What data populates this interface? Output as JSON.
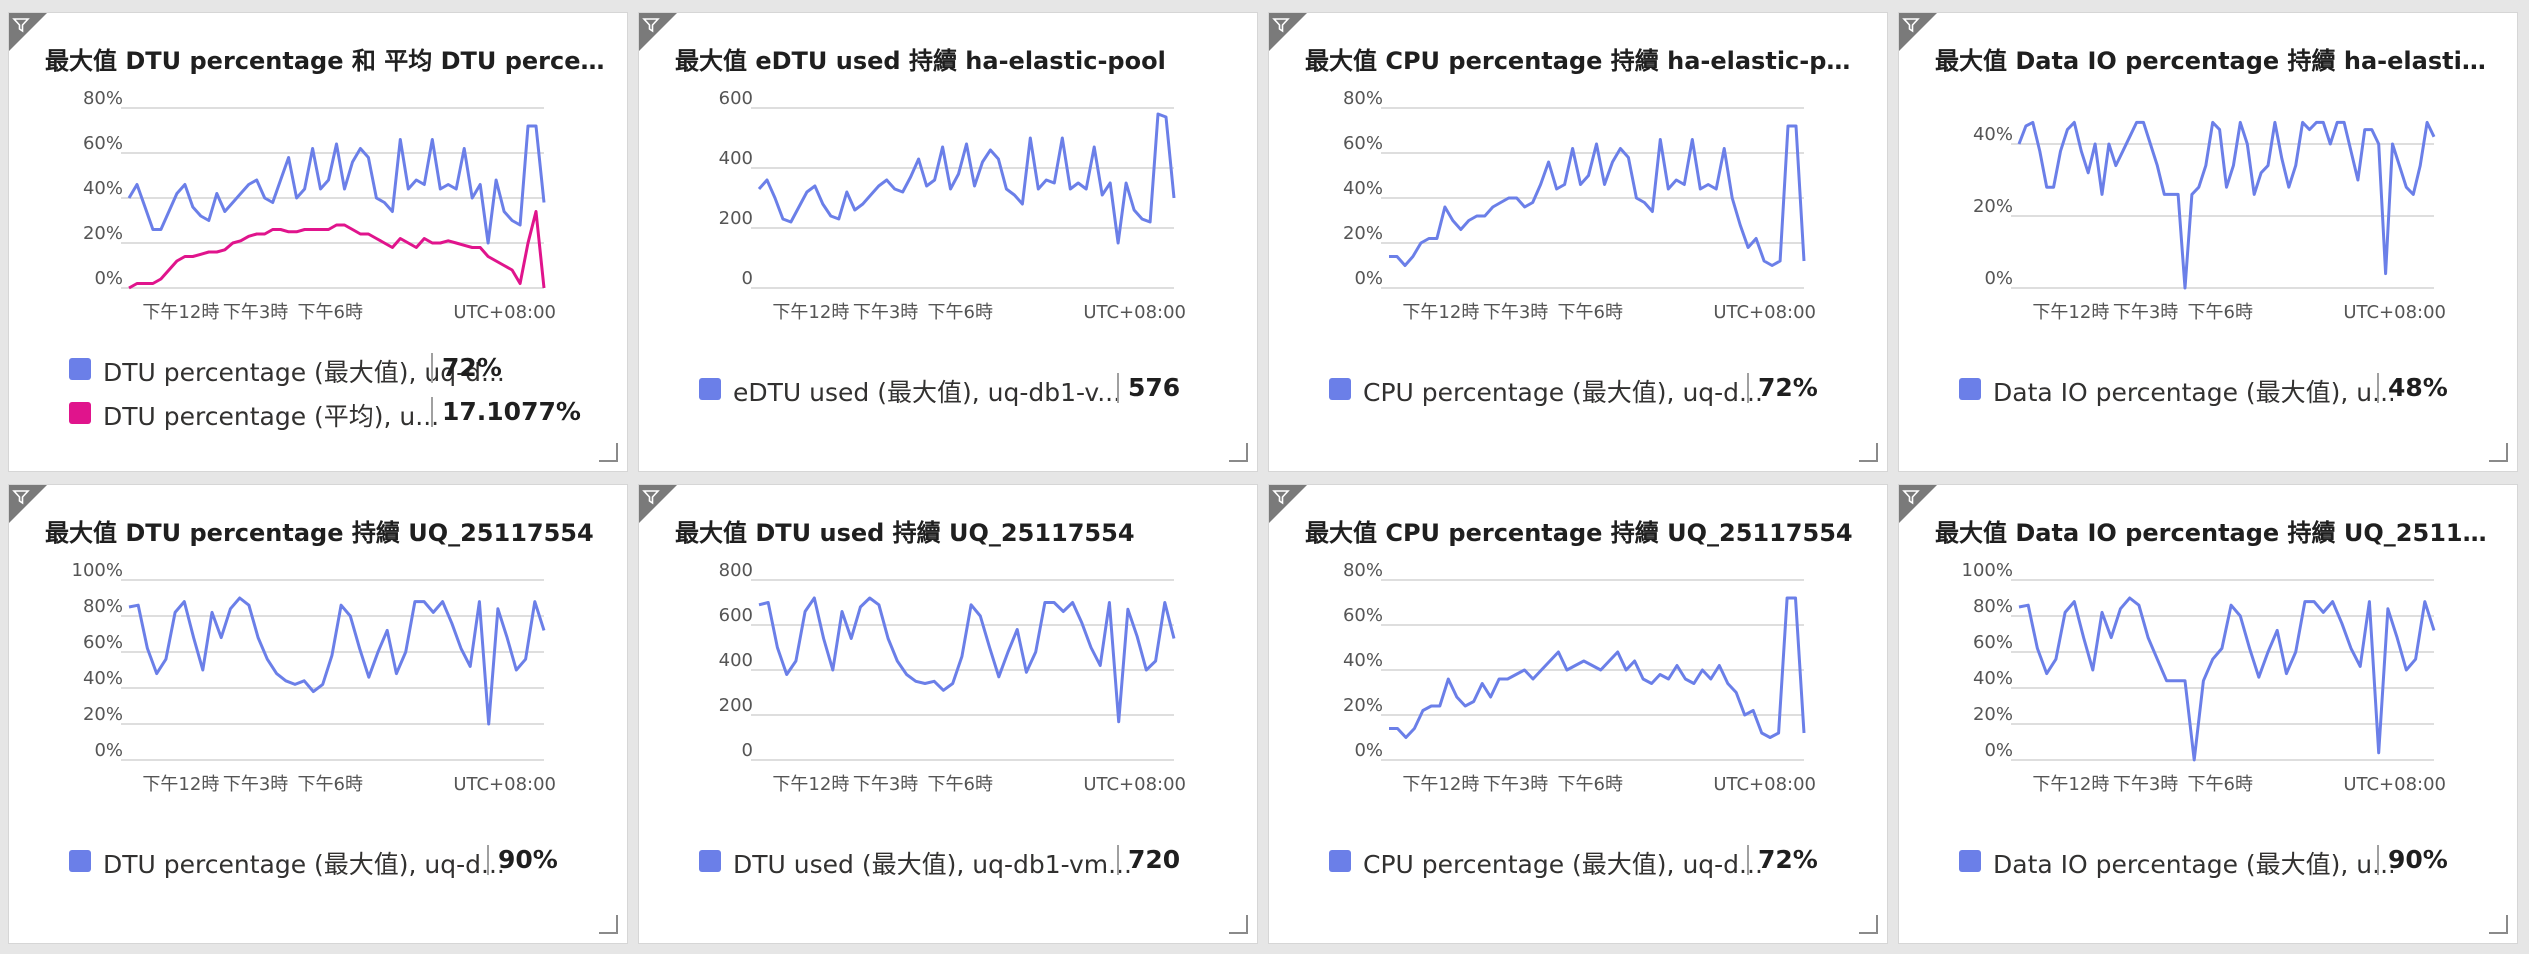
{
  "colors": {
    "blue": "#6b7fe8",
    "pink": "#e0148c"
  },
  "x_tick_labels": [
    "下午12時",
    "下午3時",
    "下午6時"
  ],
  "timezone_label": "UTC+08:00",
  "tiles": [
    {
      "title": "最大值 DTU percentage 和 平均 DTU percen...",
      "legend": [
        {
          "label": "DTU percentage (最大值), uq-d...",
          "value": "72%",
          "color": "#6b7fe8"
        },
        {
          "label": "DTU percentage (平均), u...",
          "value": "17.1077%",
          "color": "#e0148c"
        }
      ]
    },
    {
      "title": "最大值 eDTU used 持續 ha-elastic-pool",
      "legend": [
        {
          "label": "eDTU used (最大值), uq-db1-v...",
          "value": "576",
          "color": "#6b7fe8"
        }
      ]
    },
    {
      "title": "最大值 CPU percentage 持續 ha-elastic-pool",
      "legend": [
        {
          "label": "CPU percentage (最大值), uq-d...",
          "value": "72%",
          "color": "#6b7fe8"
        }
      ]
    },
    {
      "title": "最大值 Data IO percentage 持續 ha-elastic-...",
      "legend": [
        {
          "label": "Data IO percentage (最大值), u...",
          "value": "48%",
          "color": "#6b7fe8"
        }
      ]
    },
    {
      "title": "最大值 DTU percentage 持續 UQ_25117554",
      "legend": [
        {
          "label": "DTU percentage (最大值), uq-d...",
          "value": "90%",
          "color": "#6b7fe8"
        }
      ]
    },
    {
      "title": "最大值 DTU used 持續 UQ_25117554",
      "legend": [
        {
          "label": "DTU used (最大值), uq-db1-vm...",
          "value": "720",
          "color": "#6b7fe8"
        }
      ]
    },
    {
      "title": "最大值 CPU percentage 持續 UQ_25117554",
      "legend": [
        {
          "label": "CPU percentage (最大值), uq-d...",
          "value": "72%",
          "color": "#6b7fe8"
        }
      ]
    },
    {
      "title": "最大值 Data IO percentage 持續 UQ_25117...",
      "legend": [
        {
          "label": "Data IO percentage (最大值), u...",
          "value": "90%",
          "color": "#6b7fe8"
        }
      ]
    }
  ],
  "chart_data": [
    {
      "type": "line",
      "title": "最大值 DTU percentage 和 平均 DTU percen...",
      "y_ticks": [
        "0%",
        "20%",
        "40%",
        "60%",
        "80%"
      ],
      "ylim": [
        0,
        80
      ],
      "grid": true,
      "legend_position": "bottom",
      "series": [
        {
          "name": "DTU percentage (最大值), uq-d...",
          "color": "#6b7fe8",
          "values": [
            40,
            46,
            36,
            26,
            26,
            34,
            42,
            46,
            36,
            32,
            30,
            42,
            34,
            38,
            42,
            46,
            48,
            40,
            38,
            48,
            58,
            40,
            44,
            62,
            44,
            48,
            64,
            44,
            56,
            62,
            58,
            40,
            38,
            34,
            66,
            44,
            48,
            46,
            66,
            44,
            46,
            44,
            62,
            40,
            46,
            20,
            48,
            34,
            30,
            28,
            72,
            72,
            38
          ]
        },
        {
          "name": "DTU percentage (平均), u...",
          "color": "#e0148c",
          "values": [
            0,
            2,
            2,
            2,
            4,
            8,
            12,
            14,
            14,
            15,
            16,
            16,
            17,
            20,
            21,
            23,
            24,
            24,
            26,
            26,
            25,
            25,
            26,
            26,
            26,
            26,
            28,
            28,
            26,
            24,
            24,
            22,
            20,
            18,
            22,
            20,
            18,
            22,
            20,
            20,
            21,
            20,
            19,
            18,
            18,
            14,
            12,
            10,
            8,
            2,
            20,
            34,
            0
          ]
        }
      ]
    },
    {
      "type": "line",
      "title": "最大值 eDTU used 持續 ha-elastic-pool",
      "y_ticks": [
        "0",
        "200",
        "400",
        "600"
      ],
      "ylim": [
        0,
        600
      ],
      "grid": true,
      "legend_position": "bottom",
      "series": [
        {
          "name": "eDTU used (最大值), uq-db1-v...",
          "color": "#6b7fe8",
          "values": [
            330,
            360,
            300,
            230,
            220,
            270,
            320,
            340,
            280,
            240,
            230,
            320,
            260,
            280,
            310,
            340,
            360,
            330,
            320,
            370,
            430,
            340,
            360,
            470,
            330,
            380,
            480,
            340,
            420,
            460,
            430,
            330,
            310,
            280,
            500,
            330,
            360,
            350,
            500,
            330,
            350,
            330,
            470,
            310,
            350,
            150,
            350,
            260,
            230,
            220,
            580,
            570,
            300
          ]
        }
      ]
    },
    {
      "type": "line",
      "title": "最大值 CPU percentage 持續 ha-elastic-pool",
      "y_ticks": [
        "0%",
        "20%",
        "40%",
        "60%",
        "80%"
      ],
      "ylim": [
        0,
        80
      ],
      "grid": true,
      "legend_position": "bottom",
      "series": [
        {
          "name": "CPU percentage (最大值), uq-d...",
          "color": "#6b7fe8",
          "values": [
            14,
            14,
            10,
            14,
            20,
            22,
            22,
            36,
            30,
            26,
            30,
            32,
            32,
            36,
            38,
            40,
            40,
            36,
            38,
            46,
            56,
            44,
            46,
            62,
            46,
            50,
            64,
            46,
            56,
            62,
            58,
            40,
            38,
            34,
            66,
            44,
            48,
            46,
            66,
            44,
            46,
            44,
            62,
            40,
            28,
            18,
            22,
            12,
            10,
            12,
            72,
            72,
            12
          ]
        }
      ]
    },
    {
      "type": "line",
      "title": "最大值 Data IO percentage 持續 ha-elastic-...",
      "y_ticks": [
        "0%",
        "20%",
        "40%"
      ],
      "ylim": [
        0,
        50
      ],
      "grid": true,
      "legend_position": "bottom",
      "series": [
        {
          "name": "Data IO percentage (最大值), u...",
          "color": "#6b7fe8",
          "values": [
            40,
            45,
            46,
            38,
            28,
            28,
            38,
            44,
            46,
            38,
            32,
            40,
            26,
            40,
            34,
            38,
            42,
            46,
            46,
            40,
            34,
            26,
            26,
            26,
            0,
            26,
            28,
            34,
            46,
            44,
            28,
            34,
            46,
            40,
            26,
            32,
            34,
            46,
            36,
            28,
            34,
            46,
            44,
            46,
            46,
            40,
            46,
            46,
            38,
            30,
            44,
            44,
            40,
            4,
            40,
            34,
            28,
            26,
            34,
            46,
            42
          ]
        }
      ]
    },
    {
      "type": "line",
      "title": "最大值 DTU percentage 持續 UQ_25117554",
      "y_ticks": [
        "0%",
        "20%",
        "40%",
        "60%",
        "80%",
        "100%"
      ],
      "ylim": [
        0,
        100
      ],
      "grid": true,
      "legend_position": "bottom",
      "series": [
        {
          "name": "DTU percentage (最大值), uq-d...",
          "color": "#6b7fe8",
          "values": [
            85,
            86,
            62,
            48,
            56,
            82,
            88,
            68,
            50,
            82,
            68,
            84,
            90,
            86,
            68,
            56,
            48,
            44,
            42,
            44,
            38,
            42,
            58,
            86,
            80,
            62,
            46,
            60,
            72,
            48,
            60,
            88,
            88,
            82,
            88,
            76,
            62,
            52,
            88,
            20,
            84,
            68,
            50,
            56,
            88,
            72
          ]
        }
      ]
    },
    {
      "type": "line",
      "title": "最大值 DTU used 持續 UQ_25117554",
      "y_ticks": [
        "0",
        "200",
        "400",
        "600",
        "800"
      ],
      "ylim": [
        0,
        800
      ],
      "grid": true,
      "legend_position": "bottom",
      "series": [
        {
          "name": "DTU used (最大值), uq-db1-vm...",
          "color": "#6b7fe8",
          "values": [
            690,
            700,
            500,
            380,
            440,
            660,
            720,
            540,
            400,
            660,
            540,
            680,
            720,
            690,
            540,
            440,
            380,
            350,
            340,
            350,
            310,
            340,
            460,
            690,
            640,
            500,
            370,
            480,
            580,
            390,
            480,
            700,
            700,
            660,
            700,
            610,
            500,
            420,
            700,
            170,
            670,
            550,
            400,
            440,
            700,
            540
          ]
        }
      ]
    },
    {
      "type": "line",
      "title": "最大值 CPU percentage 持續 UQ_25117554",
      "y_ticks": [
        "0%",
        "20%",
        "40%",
        "60%",
        "80%"
      ],
      "ylim": [
        0,
        80
      ],
      "grid": true,
      "legend_position": "bottom",
      "series": [
        {
          "name": "CPU percentage (最大值), uq-d...",
          "color": "#6b7fe8",
          "values": [
            14,
            14,
            10,
            14,
            22,
            24,
            24,
            36,
            28,
            24,
            26,
            34,
            28,
            36,
            36,
            38,
            40,
            36,
            40,
            44,
            48,
            40,
            42,
            44,
            42,
            40,
            44,
            48,
            40,
            44,
            36,
            34,
            38,
            36,
            42,
            36,
            34,
            40,
            36,
            42,
            34,
            30,
            20,
            22,
            12,
            10,
            12,
            72,
            72,
            12
          ]
        }
      ]
    },
    {
      "type": "line",
      "title": "最大值 Data IO percentage 持續 UQ_25117...",
      "y_ticks": [
        "0%",
        "20%",
        "40%",
        "60%",
        "80%",
        "100%"
      ],
      "ylim": [
        0,
        100
      ],
      "grid": true,
      "legend_position": "bottom",
      "series": [
        {
          "name": "Data IO percentage (最大值), u...",
          "color": "#6b7fe8",
          "values": [
            85,
            86,
            62,
            48,
            56,
            82,
            88,
            68,
            50,
            82,
            68,
            84,
            90,
            86,
            68,
            56,
            44,
            44,
            44,
            0,
            44,
            56,
            62,
            86,
            80,
            62,
            46,
            60,
            72,
            48,
            60,
            88,
            88,
            82,
            88,
            76,
            62,
            52,
            88,
            4,
            84,
            68,
            50,
            56,
            88,
            72
          ]
        }
      ]
    }
  ]
}
